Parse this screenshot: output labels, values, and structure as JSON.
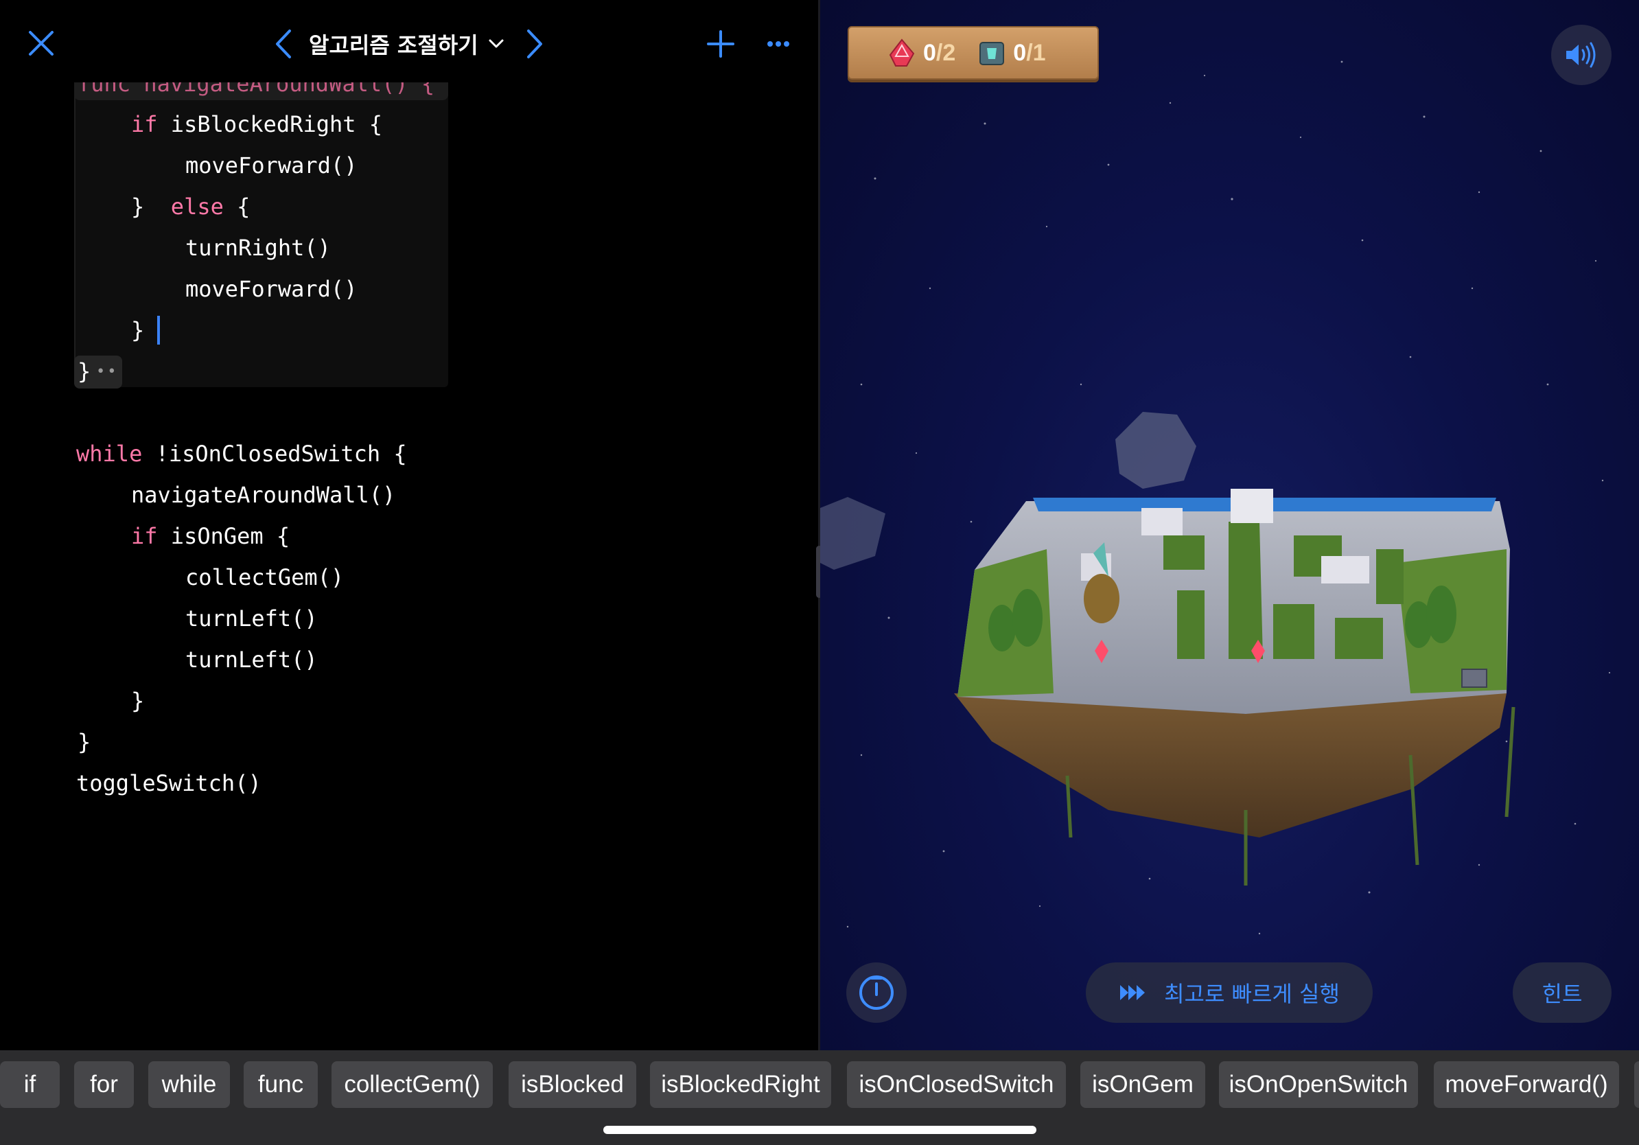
{
  "nav": {
    "title": "알고리즘 조절하기",
    "close_icon": "close-icon",
    "prev_icon": "chevron-left-icon",
    "next_icon": "chevron-right-icon",
    "add_icon": "plus-icon",
    "more_icon": "more-icon"
  },
  "code": {
    "l0_kw": "func",
    "l0_rest": " navigateAroundWall() {",
    "l1_kw": "if",
    "l1_rest": " isBlockedRight {",
    "l2": "moveForward()",
    "l3_a": "}  ",
    "l3_kw": "else",
    "l3_b": " {",
    "l4": "turnRight()",
    "l5": "moveForward()",
    "l6": "}",
    "l7": "}",
    "l9_kw": "while",
    "l9_rest": " !isOnClosedSwitch {",
    "l10": "navigateAroundWall()",
    "l11_kw": "if",
    "l11_rest": " isOnGem {",
    "l12": "collectGem()",
    "l13": "turnLeft()",
    "l14": "turnLeft()",
    "l15": "}",
    "l16": "}",
    "l17": "toggleSwitch()"
  },
  "game": {
    "gems_collected": "0",
    "gems_total": "/2",
    "switches_toggled": "0",
    "switches_total": "/1",
    "gem_icon": "gem-icon",
    "switch_icon": "switch-icon",
    "sound_icon": "speaker-icon",
    "speed_icon": "speedometer-icon",
    "run_label": "최고로 빠르게 실행",
    "run_icon": "fast-forward-icon",
    "hint_label": "힌트",
    "colors": {
      "accent": "#3e8dff",
      "keyword": "#ff79a8",
      "sky": "#0c1148"
    }
  },
  "shortcuts": [
    "if",
    "for",
    "while",
    "func",
    "collectGem()",
    "isBlocked",
    "isBlockedRight",
    "isOnClosedSwitch",
    "isOnGem",
    "isOnOpenSwitch",
    "moveForward()"
  ]
}
